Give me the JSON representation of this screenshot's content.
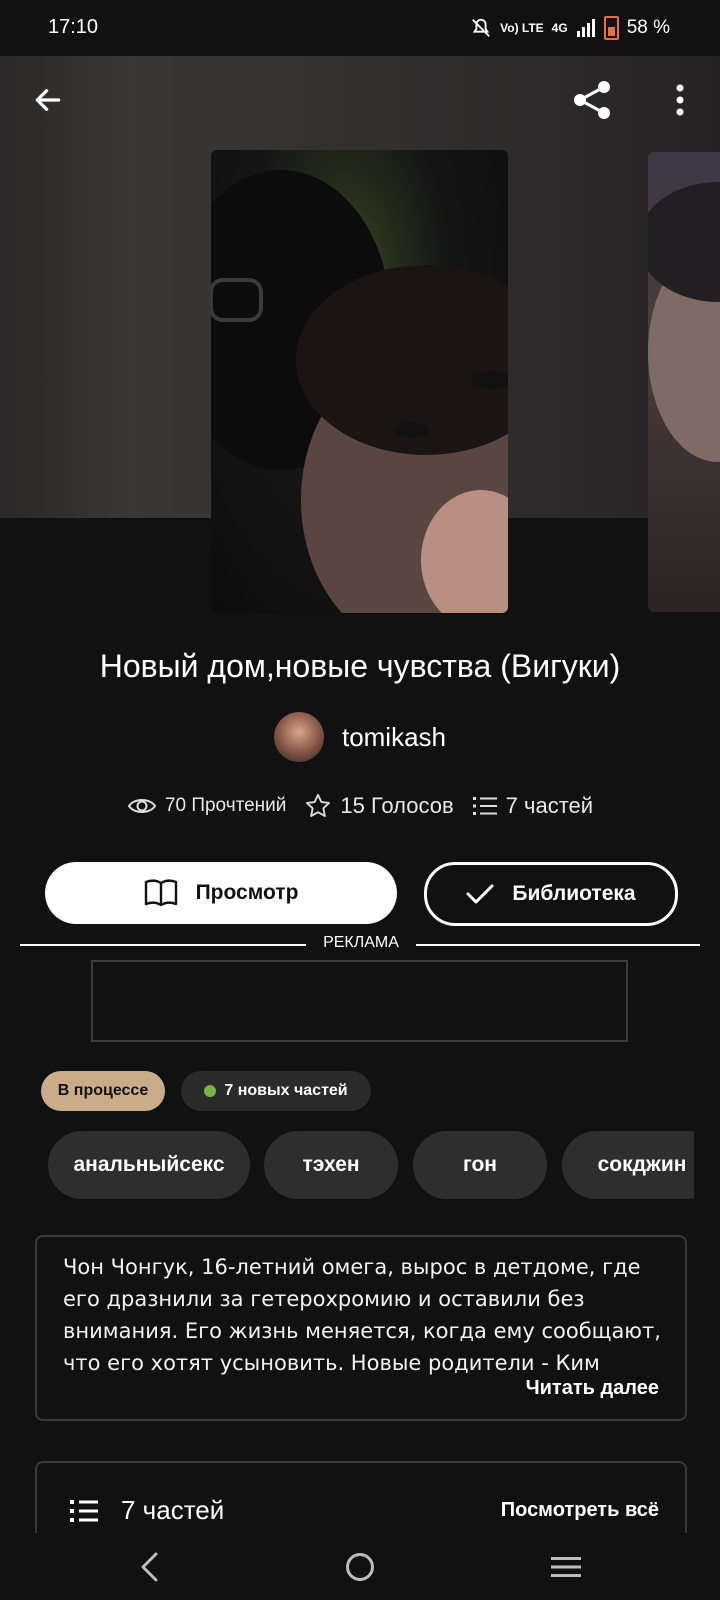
{
  "status_bar": {
    "time": "17:10",
    "volte": "Vo) LTE",
    "network": "4G",
    "battery": "58 %"
  },
  "story": {
    "title": "Новый дом,новые чувства (Вигуки)",
    "author": "tomikash",
    "stats": {
      "reads": "70 Прочтений",
      "votes": "15 Голосов",
      "parts": "7 частей"
    },
    "status_badge": "В процессе",
    "new_parts_badge": "7 новых частей",
    "tags": [
      "анальныйсекс",
      "тэхен",
      "гон",
      "сокджин"
    ],
    "description": "Чон Чонгук, 16-летний омега, вырос в детдоме, где его дразнили за гетерохромию и оставили без внимания. Его жизнь меняется, когда ему сообщают, что его хотят усыновить. Новые родители - Ким Сокджин и Ким",
    "read_more": "Читать далее"
  },
  "actions": {
    "view_label": "Просмотр",
    "library_label": "Библиотека"
  },
  "ad": {
    "label": "РЕКЛАМА"
  },
  "parts_section": {
    "title": "7 частей",
    "view_all": "Посмотреть всё"
  },
  "icons": [
    "back-arrow-icon",
    "share-icon",
    "more-vertical-icon",
    "eye-icon",
    "star-icon",
    "list-icon",
    "book-icon",
    "check-icon",
    "nav-back-icon",
    "nav-home-icon",
    "nav-recents-icon"
  ],
  "colors": {
    "background": "#121112",
    "progress_badge": "#c9ad8a",
    "new_dot": "#7bb244",
    "tag_bg": "#2f2e2e"
  }
}
